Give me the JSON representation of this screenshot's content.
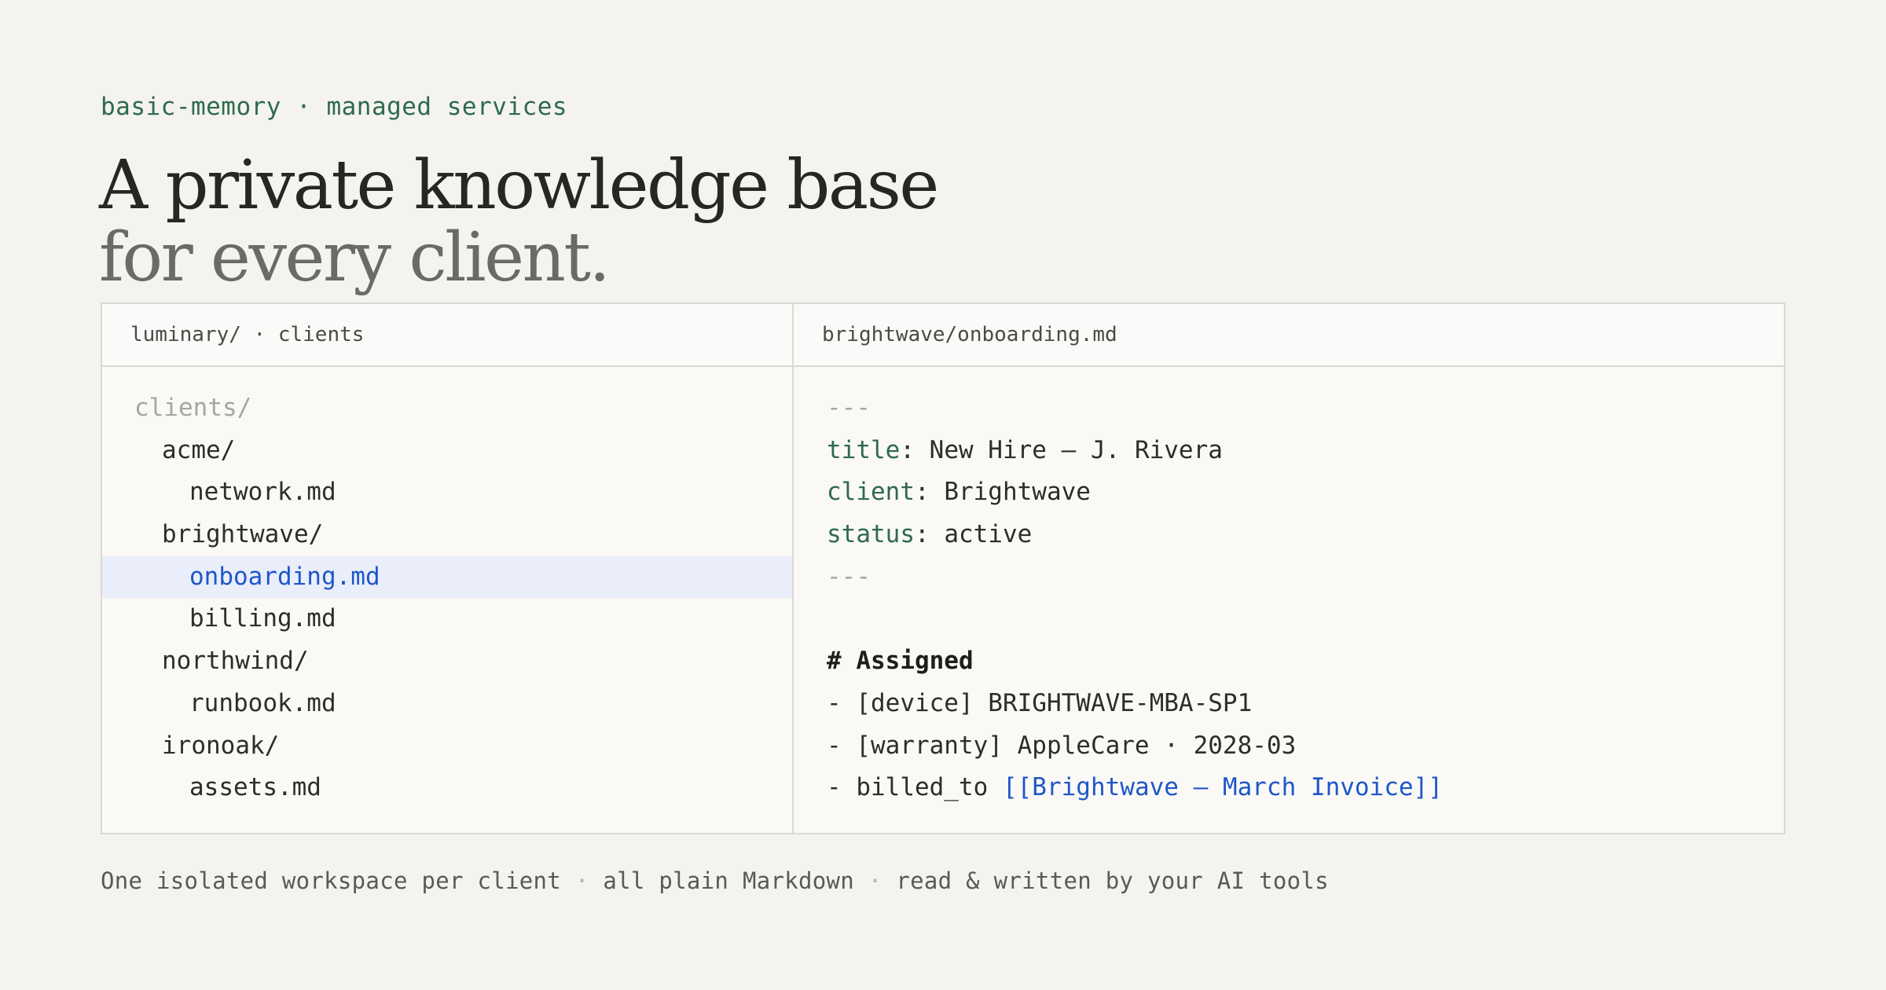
{
  "eyebrow": "basic-memory · managed services",
  "headline": {
    "line1": "A private knowledge base",
    "line2": "for every client."
  },
  "left_pane": {
    "header": "luminary/ · clients",
    "tree": [
      {
        "label": "clients/",
        "depth": 0,
        "type": "folder"
      },
      {
        "label": "acme/",
        "depth": 1,
        "type": "folder"
      },
      {
        "label": "network.md",
        "depth": 2,
        "type": "file"
      },
      {
        "label": "brightwave/",
        "depth": 1,
        "type": "folder"
      },
      {
        "label": "onboarding.md",
        "depth": 2,
        "type": "file",
        "selected": true
      },
      {
        "label": "billing.md",
        "depth": 2,
        "type": "file"
      },
      {
        "label": "northwind/",
        "depth": 1,
        "type": "folder"
      },
      {
        "label": "runbook.md",
        "depth": 2,
        "type": "file"
      },
      {
        "label": "ironoak/",
        "depth": 1,
        "type": "folder"
      },
      {
        "label": "assets.md",
        "depth": 2,
        "type": "file"
      }
    ]
  },
  "right_pane": {
    "header": "brightwave/onboarding.md",
    "frontmatter_delimiter": "---",
    "frontmatter": [
      {
        "key": "title",
        "value": "New Hire — J. Rivera"
      },
      {
        "key": "client",
        "value": "Brightwave"
      },
      {
        "key": "status",
        "value": "active"
      }
    ],
    "heading": "# Assigned",
    "items": [
      {
        "text": "- [device] BRIGHTWAVE-MBA-SP1"
      },
      {
        "text": "- [warranty] AppleCare · 2028-03"
      },
      {
        "text": "- billed_to ",
        "link": "[[Brightwave — March Invoice]]"
      }
    ]
  },
  "footer": {
    "parts": [
      "One isolated workspace per client",
      "all plain Markdown",
      "read & written by your AI tools"
    ],
    "separator": "·"
  },
  "colors": {
    "background": "#f4f3ef",
    "accent_green": "#2f6a4c",
    "link_blue": "#1f56c9",
    "selected_row": "#e9eefa"
  }
}
